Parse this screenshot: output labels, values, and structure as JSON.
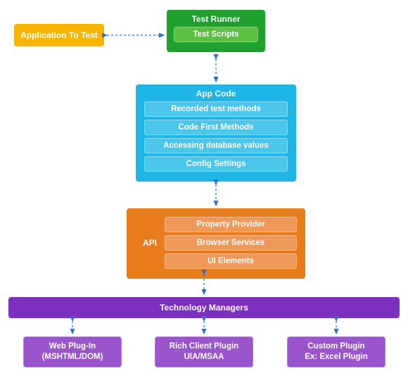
{
  "colors": {
    "green_dark": "#1fa02f",
    "green_light": "#5bbf42",
    "amber": "#f7b500",
    "blue": "#1fb5e6",
    "blue_light": "#4cc6eb",
    "orange": "#e87b1a",
    "orange_light": "#ee985a",
    "purple_dark": "#7d2fbf",
    "purple_light": "#9a55cc",
    "arrow": "#2f6fd0"
  },
  "runner": {
    "title": "Test Runner",
    "items": [
      "Test Scripts"
    ]
  },
  "app_to_test": "Application To Test",
  "app_code": {
    "title": "App Code",
    "items": [
      "Recorded test methods",
      "Code First Methods",
      "Accessing database values",
      "Config Settings"
    ]
  },
  "api": {
    "label": "API",
    "items": [
      "Property Provider",
      "Browser Services",
      "UI Elements"
    ]
  },
  "tech_managers": "Technology Managers",
  "plugins": [
    {
      "line1": "Web Plug-In",
      "line2": "(MSHTML/DOM)"
    },
    {
      "line1": "Rich Client Plugin",
      "line2": "UIA/MSAA"
    },
    {
      "line1": "Custom Plugin",
      "line2": "Ex: Excel Plugin"
    }
  ]
}
